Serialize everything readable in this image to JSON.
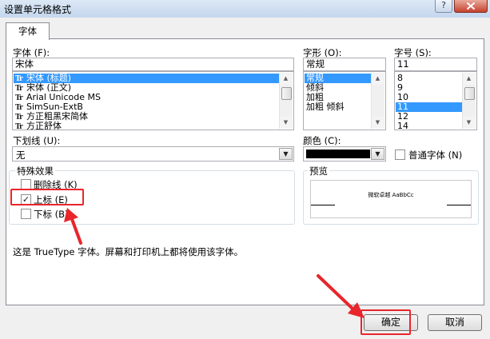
{
  "window": {
    "title": "设置单元格格式",
    "help_label": "?"
  },
  "tabs": [
    {
      "label": "字体"
    }
  ],
  "font": {
    "label": "字体 (F):",
    "value": "宋体",
    "items": [
      {
        "label": "宋体 (标题)",
        "selected": true
      },
      {
        "label": "宋体 (正文)",
        "selected": false
      },
      {
        "label": "Arial Unicode MS",
        "selected": false
      },
      {
        "label": "SimSun-ExtB",
        "selected": false
      },
      {
        "label": "方正粗黑宋简体",
        "selected": false
      },
      {
        "label": "方正舒体",
        "selected": false
      }
    ]
  },
  "style": {
    "label": "字形 (O):",
    "value": "常规",
    "items": [
      {
        "label": "常规",
        "selected": true
      },
      {
        "label": "倾斜",
        "selected": false
      },
      {
        "label": "加粗",
        "selected": false
      },
      {
        "label": "加粗 倾斜",
        "selected": false
      }
    ]
  },
  "size": {
    "label": "字号 (S):",
    "value": "11",
    "items": [
      {
        "label": "8",
        "selected": false
      },
      {
        "label": "9",
        "selected": false
      },
      {
        "label": "10",
        "selected": false
      },
      {
        "label": "11",
        "selected": true
      },
      {
        "label": "12",
        "selected": false
      },
      {
        "label": "14",
        "selected": false
      }
    ]
  },
  "underline": {
    "label": "下划线 (U):",
    "value": "无"
  },
  "color": {
    "label": "颜色 (C):",
    "swatch": "#000000",
    "normal_font_label": "普通字体 (N)",
    "normal_font_checked": false
  },
  "effects": {
    "group_label": "特殊效果",
    "strikethrough": {
      "label": "删除线 (K)",
      "checked": false
    },
    "superscript": {
      "label": "上标 (E)",
      "checked": true
    },
    "subscript": {
      "label": "下标 (B)",
      "checked": false
    }
  },
  "preview": {
    "group_label": "预览",
    "sample_text": "微软卓越 AaBbCc"
  },
  "info_text": "这是 TrueType 字体。屏幕和打印机上都将使用该字体。",
  "buttons": {
    "ok_label": "确定",
    "cancel_label": "取消"
  },
  "colors": {
    "highlight": "#e8262b",
    "selection": "#3399ff"
  }
}
